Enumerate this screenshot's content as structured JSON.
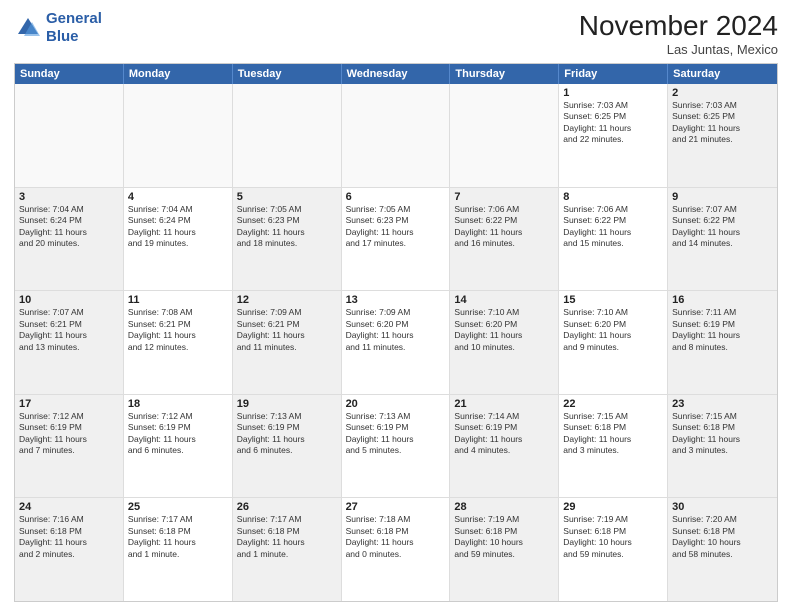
{
  "logo": {
    "line1": "General",
    "line2": "Blue"
  },
  "title": "November 2024",
  "location": "Las Juntas, Mexico",
  "header_days": [
    "Sunday",
    "Monday",
    "Tuesday",
    "Wednesday",
    "Thursday",
    "Friday",
    "Saturday"
  ],
  "weeks": [
    [
      {
        "day": "",
        "text": "",
        "empty": true
      },
      {
        "day": "",
        "text": "",
        "empty": true
      },
      {
        "day": "",
        "text": "",
        "empty": true
      },
      {
        "day": "",
        "text": "",
        "empty": true
      },
      {
        "day": "",
        "text": "",
        "empty": true
      },
      {
        "day": "1",
        "text": "Sunrise: 7:03 AM\nSunset: 6:25 PM\nDaylight: 11 hours\nand 22 minutes."
      },
      {
        "day": "2",
        "text": "Sunrise: 7:03 AM\nSunset: 6:25 PM\nDaylight: 11 hours\nand 21 minutes.",
        "shaded": true
      }
    ],
    [
      {
        "day": "3",
        "text": "Sunrise: 7:04 AM\nSunset: 6:24 PM\nDaylight: 11 hours\nand 20 minutes.",
        "shaded": true
      },
      {
        "day": "4",
        "text": "Sunrise: 7:04 AM\nSunset: 6:24 PM\nDaylight: 11 hours\nand 19 minutes."
      },
      {
        "day": "5",
        "text": "Sunrise: 7:05 AM\nSunset: 6:23 PM\nDaylight: 11 hours\nand 18 minutes.",
        "shaded": true
      },
      {
        "day": "6",
        "text": "Sunrise: 7:05 AM\nSunset: 6:23 PM\nDaylight: 11 hours\nand 17 minutes."
      },
      {
        "day": "7",
        "text": "Sunrise: 7:06 AM\nSunset: 6:22 PM\nDaylight: 11 hours\nand 16 minutes.",
        "shaded": true
      },
      {
        "day": "8",
        "text": "Sunrise: 7:06 AM\nSunset: 6:22 PM\nDaylight: 11 hours\nand 15 minutes."
      },
      {
        "day": "9",
        "text": "Sunrise: 7:07 AM\nSunset: 6:22 PM\nDaylight: 11 hours\nand 14 minutes.",
        "shaded": true
      }
    ],
    [
      {
        "day": "10",
        "text": "Sunrise: 7:07 AM\nSunset: 6:21 PM\nDaylight: 11 hours\nand 13 minutes.",
        "shaded": true
      },
      {
        "day": "11",
        "text": "Sunrise: 7:08 AM\nSunset: 6:21 PM\nDaylight: 11 hours\nand 12 minutes."
      },
      {
        "day": "12",
        "text": "Sunrise: 7:09 AM\nSunset: 6:21 PM\nDaylight: 11 hours\nand 11 minutes.",
        "shaded": true
      },
      {
        "day": "13",
        "text": "Sunrise: 7:09 AM\nSunset: 6:20 PM\nDaylight: 11 hours\nand 11 minutes."
      },
      {
        "day": "14",
        "text": "Sunrise: 7:10 AM\nSunset: 6:20 PM\nDaylight: 11 hours\nand 10 minutes.",
        "shaded": true
      },
      {
        "day": "15",
        "text": "Sunrise: 7:10 AM\nSunset: 6:20 PM\nDaylight: 11 hours\nand 9 minutes."
      },
      {
        "day": "16",
        "text": "Sunrise: 7:11 AM\nSunset: 6:19 PM\nDaylight: 11 hours\nand 8 minutes.",
        "shaded": true
      }
    ],
    [
      {
        "day": "17",
        "text": "Sunrise: 7:12 AM\nSunset: 6:19 PM\nDaylight: 11 hours\nand 7 minutes.",
        "shaded": true
      },
      {
        "day": "18",
        "text": "Sunrise: 7:12 AM\nSunset: 6:19 PM\nDaylight: 11 hours\nand 6 minutes."
      },
      {
        "day": "19",
        "text": "Sunrise: 7:13 AM\nSunset: 6:19 PM\nDaylight: 11 hours\nand 6 minutes.",
        "shaded": true
      },
      {
        "day": "20",
        "text": "Sunrise: 7:13 AM\nSunset: 6:19 PM\nDaylight: 11 hours\nand 5 minutes."
      },
      {
        "day": "21",
        "text": "Sunrise: 7:14 AM\nSunset: 6:19 PM\nDaylight: 11 hours\nand 4 minutes.",
        "shaded": true
      },
      {
        "day": "22",
        "text": "Sunrise: 7:15 AM\nSunset: 6:18 PM\nDaylight: 11 hours\nand 3 minutes."
      },
      {
        "day": "23",
        "text": "Sunrise: 7:15 AM\nSunset: 6:18 PM\nDaylight: 11 hours\nand 3 minutes.",
        "shaded": true
      }
    ],
    [
      {
        "day": "24",
        "text": "Sunrise: 7:16 AM\nSunset: 6:18 PM\nDaylight: 11 hours\nand 2 minutes.",
        "shaded": true
      },
      {
        "day": "25",
        "text": "Sunrise: 7:17 AM\nSunset: 6:18 PM\nDaylight: 11 hours\nand 1 minute."
      },
      {
        "day": "26",
        "text": "Sunrise: 7:17 AM\nSunset: 6:18 PM\nDaylight: 11 hours\nand 1 minute.",
        "shaded": true
      },
      {
        "day": "27",
        "text": "Sunrise: 7:18 AM\nSunset: 6:18 PM\nDaylight: 11 hours\nand 0 minutes."
      },
      {
        "day": "28",
        "text": "Sunrise: 7:19 AM\nSunset: 6:18 PM\nDaylight: 10 hours\nand 59 minutes.",
        "shaded": true
      },
      {
        "day": "29",
        "text": "Sunrise: 7:19 AM\nSunset: 6:18 PM\nDaylight: 10 hours\nand 59 minutes."
      },
      {
        "day": "30",
        "text": "Sunrise: 7:20 AM\nSunset: 6:18 PM\nDaylight: 10 hours\nand 58 minutes.",
        "shaded": true
      }
    ]
  ]
}
